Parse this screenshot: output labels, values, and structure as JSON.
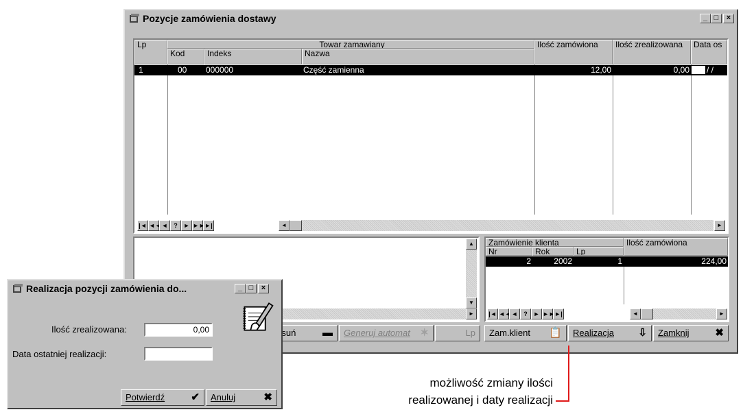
{
  "main_window": {
    "title": "Pozycje zamówienia dostawy",
    "grid": {
      "header_lp": "Lp",
      "header_group": "Towar zamawiany",
      "header_kod": "Kod",
      "header_indeks": "Indeks",
      "header_nazwa": "Nazwa",
      "header_ilosc_zam": "Ilość zamówiona",
      "header_ilosc_zreal": "Ilość zrealizowana",
      "header_data": "Data os",
      "rows": [
        {
          "lp": "1",
          "kod": "00",
          "indeks": "000000",
          "nazwa": "Część zamienna",
          "ilosc_zam": "12,00",
          "ilosc_zreal": "0,00",
          "data": "  /  /"
        }
      ]
    },
    "nav_buttons": [
      "|◄",
      "◄◄",
      "◄",
      "?",
      "►",
      "►►",
      "►|"
    ],
    "client_grid": {
      "header_group": "Zamówienie klienta",
      "header_nr": "Nr",
      "header_rok": "Rok",
      "header_lp": "Lp",
      "header_ilosc": "Ilość zamówiona",
      "rows": [
        {
          "nr": "2",
          "rok": "2002",
          "lp": "1",
          "ilosc": "224,00"
        }
      ]
    },
    "buttons": {
      "usun": "Usuń",
      "generuj": "Generuj automat",
      "lp": "Lp",
      "zam_klient": "Zam.klient",
      "realizacja": "Realizacja",
      "zamknij": "Zamknij"
    }
  },
  "dialog": {
    "title": "Realizacja pozycji zamówienia do...",
    "label_ilosc": "Ilość zrealizowana:",
    "value_ilosc": "0,00",
    "label_data": "Data ostatniej realizacji:",
    "value_data": "",
    "btn_potwierdz": "Potwierdź",
    "btn_anuluj": "Anuluj"
  },
  "annotation": {
    "line1": "możliwość zmiany ilości",
    "line2": "realizowanej i daty realizacji"
  }
}
